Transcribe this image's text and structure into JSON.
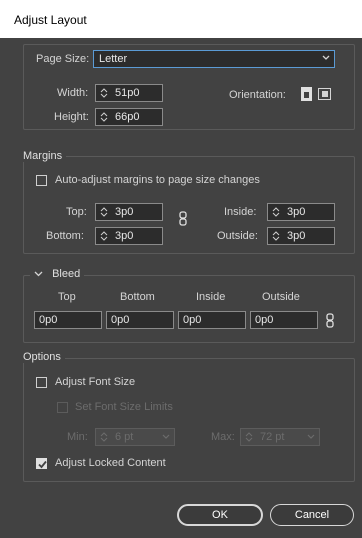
{
  "dialog": {
    "title": "Adjust Layout"
  },
  "page": {
    "page_size_label": "Page Size:",
    "page_size_value": "Letter",
    "width_label": "Width:",
    "width_value": "51p0",
    "height_label": "Height:",
    "height_value": "66p0",
    "orientation_label": "Orientation:",
    "icons": [
      "portrait-orientation-icon",
      "landscape-orientation-icon"
    ]
  },
  "margins": {
    "title": "Margins",
    "auto_adjust_label": "Auto-adjust margins to page size changes",
    "auto_adjust_checked": false,
    "top_label": "Top:",
    "top_value": "3p0",
    "bottom_label": "Bottom:",
    "bottom_value": "3p0",
    "inside_label": "Inside:",
    "inside_value": "3p0",
    "outside_label": "Outside:",
    "outside_value": "3p0"
  },
  "bleed": {
    "title": "Bleed",
    "columns": [
      "Top",
      "Bottom",
      "Inside",
      "Outside"
    ],
    "values": [
      "0p0",
      "0p0",
      "0p0",
      "0p0"
    ]
  },
  "options": {
    "title": "Options",
    "adjust_font_size_label": "Adjust Font Size",
    "adjust_font_size_checked": false,
    "set_font_limits_label": "Set Font Size Limits",
    "set_font_limits_checked": false,
    "min_label": "Min:",
    "min_value": "6 pt",
    "max_label": "Max:",
    "max_value": "72 pt",
    "adjust_locked_label": "Adjust Locked Content",
    "adjust_locked_checked": true
  },
  "buttons": {
    "ok": "OK",
    "cancel": "Cancel"
  },
  "colors": {
    "dialog_bg": "#424242",
    "field_bg": "#2c2c2c",
    "focus_border": "#5b9bd5"
  }
}
